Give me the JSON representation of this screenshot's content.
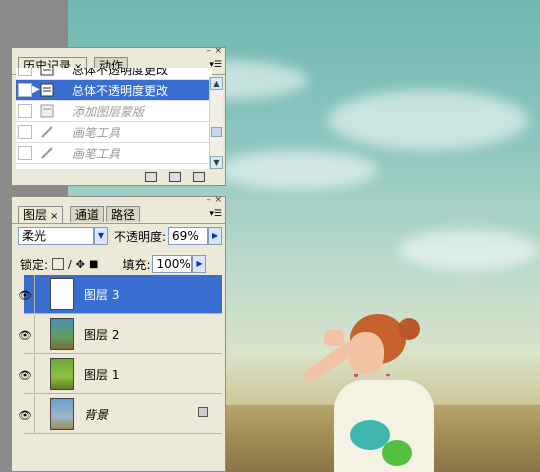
{
  "history_panel": {
    "tabs": [
      {
        "label": "历史记录",
        "close": "×"
      },
      {
        "label": "动作"
      }
    ],
    "items": [
      {
        "label": "总体不透明度更改",
        "state": "partial"
      },
      {
        "label": "总体不透明度更改",
        "state": "selected"
      },
      {
        "label": "添加图层蒙版",
        "state": "inactive"
      },
      {
        "label": "画笔工具",
        "state": "inactive"
      },
      {
        "label": "画笔工具",
        "state": "inactive"
      }
    ],
    "icons": [
      "new-document-icon",
      "snapshot-icon",
      "trash-icon"
    ]
  },
  "layers_panel": {
    "tabs": [
      {
        "label": "图层",
        "close": "×"
      },
      {
        "label": "通道"
      },
      {
        "label": "路径"
      }
    ],
    "blend_mode": "柔光",
    "opacity_label": "不透明度:",
    "opacity_value": "69%",
    "lock_label": "锁定:",
    "fill_label": "填充:",
    "fill_value": "100%",
    "layers": [
      {
        "name": "图层 3",
        "selected": true
      },
      {
        "name": "图层 2",
        "selected": false
      },
      {
        "name": "图层 1",
        "selected": false
      },
      {
        "name": "背景",
        "selected": false,
        "locked": true
      }
    ]
  },
  "colors": {
    "selection": "#3a6dd0",
    "panel_bg": "#ece9d8",
    "sky": "#8cc5bf"
  }
}
